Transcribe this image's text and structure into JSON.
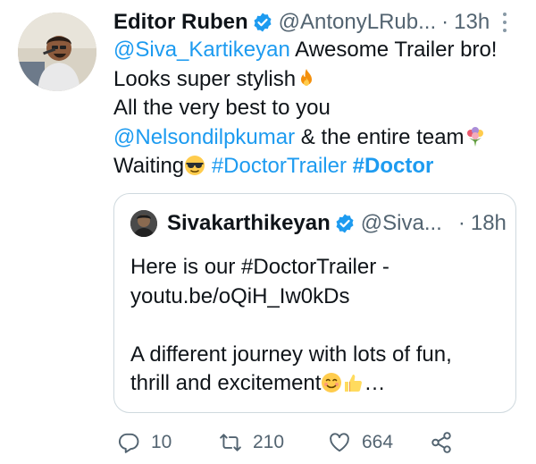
{
  "tweet": {
    "author_name": "Editor Ruben",
    "handle": "@AntonyLRub...",
    "separator": "·",
    "time": "13h",
    "verified_icon": "verified-badge-icon",
    "line1_mention": "@Siva_Kartikeyan",
    "line1_text": " Awesome Trailer bro!",
    "line2_text": "Looks super stylish",
    "line2_emoji": "fire-emoji",
    "line3_text": "All the very best to you",
    "line4_mention": "@Nelsondilpkumar",
    "line4_text": " & the entire team",
    "line4_emoji": "bouquet-emoji",
    "line5_text": "Waiting",
    "line5_emoji": "sunglasses-emoji",
    "hashtag1": "#DoctorTrailer",
    "hashtag2": "#Doctor"
  },
  "quote": {
    "author_name": "Sivakarthikeyan",
    "handle": "@Siva...",
    "separator": "·",
    "time": "18h",
    "line1": "Here is our #DoctorTrailer -",
    "line2": "youtu.be/oQiH_Iw0kDs",
    "line3": "",
    "line4": "A different journey with lots of fun,",
    "line5_text": "thrill and excitement",
    "line5_emojis": [
      "smiling-emoji",
      "thumbs-up-emoji"
    ],
    "ellipsis": "…"
  },
  "actions": {
    "reply_icon": "reply-icon",
    "reply_count": "10",
    "retweet_icon": "retweet-icon",
    "retweet_count": "210",
    "like_icon": "heart-icon",
    "like_count": "664",
    "share_icon": "share-icon"
  },
  "colors": {
    "link": "#1d9bf0",
    "text": "#0f1419",
    "secondary": "#536471",
    "border": "#cfd9de",
    "verified": "#1d9bf0"
  }
}
